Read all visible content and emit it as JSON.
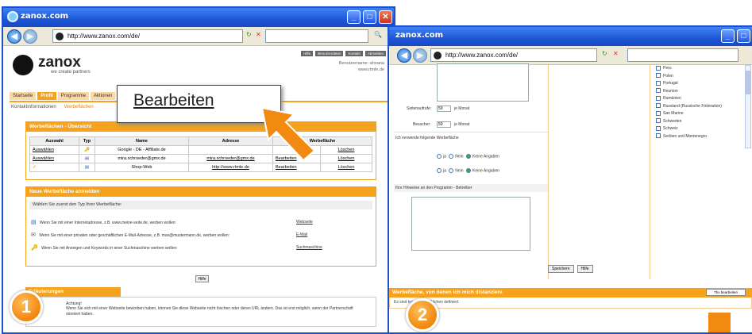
{
  "left_window": {
    "title": "zanox.com",
    "url": "http://www.zanox.com/de/",
    "logo": {
      "name": "zanox",
      "tagline": "we create partners"
    },
    "header_buttons": [
      "Hilfe",
      "Benutzerdaten",
      "Kontakt",
      "Abmelden"
    ],
    "user_info": [
      "Benutzername: ahoana",
      "www.rtmle.de"
    ],
    "tabs": [
      "Startseite",
      "Profil",
      "Programme",
      "Aktionen"
    ],
    "subtabs": [
      "Kontaktinformationen",
      "Werbeflächen"
    ],
    "overview_panel": {
      "title": "Werbeflächen - Übersicht",
      "columns": [
        "Auswahl",
        "Typ",
        "Name",
        "Adresse",
        "Werbefläche"
      ],
      "rows": [
        {
          "select": "Auswählen",
          "name": "Google - DE - Affiliate.de",
          "address": "",
          "edit": "",
          "delete": "Löschen"
        },
        {
          "select": "Auswählen",
          "name": "mira.schroeder@gmx.de",
          "address": "mira.schroeder@gmx.de",
          "edit": "Bearbeiten",
          "delete": "Löschen"
        },
        {
          "select": "",
          "name": "Shop-Web",
          "address": "http://www.rtmle.de",
          "edit": "Bearbeiten",
          "delete": "Löschen"
        }
      ]
    },
    "new_panel": {
      "title": "Neue Werbefläche anmelden",
      "intro": "Wählen Sie zuerst den Typ Ihrer Werbefläche:",
      "options": [
        {
          "text": "Wenn Sie mit einer Internetadresse, z.B. www.meine-seite.de, werben wollen:",
          "link": "Webseite"
        },
        {
          "text": "Wenn Sie mit einer privaten oder geschäftlichen E-Mail-Adresse, z.B. max@mustermann.de, werben wollen:",
          "link": "E-Mail"
        },
        {
          "text": "Wenn Sie mit Anzeigen und Keywords in einer Suchmaschine werben wollen:",
          "link": "Suchmaschine"
        }
      ]
    },
    "help_button": "Hilfe",
    "notes": {
      "title": "Erläuterungen",
      "label": "Achtung!",
      "text": "Wenn Sie sich mit einer Webseite beworben haben, können Sie diese Webseite nicht löschen oder deren URL ändern. Das ist erst möglich, wenn der Partnerschaft storniert haben."
    }
  },
  "callout": {
    "text": "Bearbeiten"
  },
  "badges": [
    "1",
    "2"
  ],
  "right_window": {
    "title": "zanox.com",
    "url": "http://www.zanox.com/de/",
    "form": {
      "visits_label": "Seitenaufrufe:",
      "visits_value": "50",
      "visits_unit": "je Monat",
      "visitors_label": "Besucher:",
      "visitors_value": "50",
      "visitors_unit": "je Monat",
      "question": "Ich verwende folgende Werbefläche",
      "radio_yes": "ja",
      "radio_no": "Nein",
      "radio_none": "Keine Angaben",
      "note_label": "Ihre Hinweise an den Programm - Betreiber"
    },
    "countries": [
      "Peru",
      "Polen",
      "Portugal",
      "Reunion",
      "Rumänien",
      "Russland (Russische Föderation)",
      "San Marino",
      "Schweden",
      "Schweiz",
      "Serbien und Montenegro"
    ],
    "buttons": [
      "Speichern",
      "Hilfe"
    ],
    "bottom_title": "Werbefläche, von denen ich mich distanziere",
    "bottom_button": "Thx bearbeiten",
    "bottom_text": "Es sind keine Werbeflächen definiert."
  }
}
